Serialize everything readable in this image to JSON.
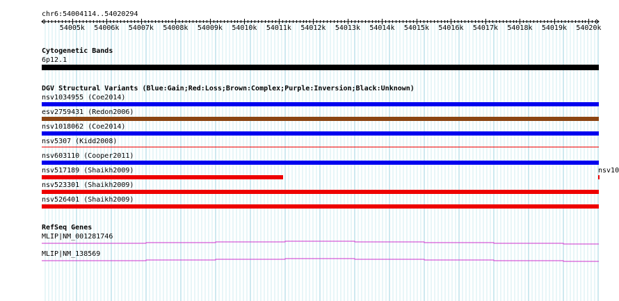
{
  "ruler": {
    "location": "chr6:54004114..54020294",
    "start": 54004114,
    "end": 54020294,
    "tick_labels": [
      "54005k",
      "54006k",
      "54007k",
      "54008k",
      "54009k",
      "54010k",
      "54011k",
      "54012k",
      "54013k",
      "54014k",
      "54015k",
      "54016k",
      "54017k",
      "54018k",
      "54019k",
      "54020k"
    ]
  },
  "tracks": {
    "cytoband": {
      "title": "Cytogenetic Bands",
      "band_label": "6p12.1",
      "band_color": "#000000"
    },
    "dgv": {
      "title": "DGV Structural Variants (Blue:Gain;Red:Loss;Brown:Complex;Purple:Inversion;Black:Unknown)",
      "features": [
        {
          "label": "nsv1034955 (Coe2014)",
          "color": "#0000ee",
          "start": 54004114,
          "end": 54020294,
          "style": "thick"
        },
        {
          "label": "esv2759431 (Redon2006)",
          "color": "#8b4513",
          "start": 54004114,
          "end": 54020294,
          "style": "thick"
        },
        {
          "label": "nsv1018062 (Coe2014)",
          "color": "#0000ee",
          "start": 54004114,
          "end": 54020294,
          "style": "thick"
        },
        {
          "label": "nsv5307 (Kidd2008)",
          "color": "#ee0000",
          "start": 54004114,
          "end": 54020294,
          "style": "thin"
        },
        {
          "label": "nsv603110 (Cooper2011)",
          "color": "#0000ee",
          "start": 54004114,
          "end": 54020294,
          "style": "thick"
        },
        {
          "label": "nsv517189 (Shaikh2009)",
          "color": "#ee0000",
          "start": 54004114,
          "end": 54011131,
          "style": "thick"
        },
        {
          "label": "nsv523301 (Shaikh2009)",
          "color": "#ee0000",
          "start": 54004114,
          "end": 54020294,
          "style": "thick"
        },
        {
          "label": "nsv526401 (Shaikh2009)",
          "color": "#ee0000",
          "start": 54004114,
          "end": 54020294,
          "style": "thick"
        }
      ],
      "overflow_label": "nsv10",
      "overflow_color": "#ee0000"
    },
    "refseq": {
      "title": "RefSeq Genes",
      "color": "#cc33cc",
      "genes": [
        {
          "label": "MLIP|NM_001281746"
        },
        {
          "label": "MLIP|NM_138569"
        }
      ]
    }
  },
  "colors": {
    "grid_major": "#9ed3e0",
    "grid_minor": "#d2ecf2",
    "ruler_line": "#000000"
  }
}
